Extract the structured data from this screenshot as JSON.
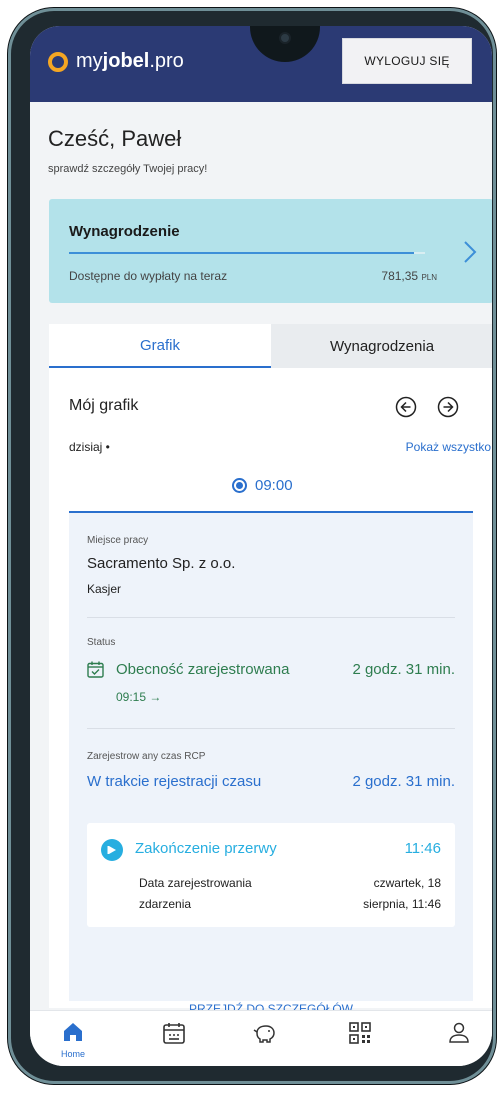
{
  "header": {
    "logo_prefix": "my",
    "logo_bold": "jobel",
    "logo_suffix": ".pro",
    "logout_label": "WYLOGUJ SIĘ"
  },
  "greeting": {
    "title": "Cześć, Paweł",
    "subtitle": "sprawdź szczegóły Twojej pracy!"
  },
  "salary_card": {
    "title": "Wynagrodzenie",
    "available_label": "Dostępne do wypłaty na teraz",
    "amount": "781,35",
    "currency": "PLN",
    "progress_fraction": 0.97
  },
  "tabs": [
    {
      "label": "Grafik",
      "active": true
    },
    {
      "label": "Wynagrodzenia",
      "active": false
    }
  ],
  "schedule": {
    "title": "Mój grafik",
    "day_label": "dzisiaj •",
    "show_all_label": "Pokaż wszystko",
    "selected_time": "09:00"
  },
  "shift": {
    "workplace_label": "Miejsce pracy",
    "workplace": "Sacramento Sp. z o.o.",
    "role": "Kasjer",
    "status_label": "Status",
    "status_text": "Obecność zarejestrowana",
    "status_duration": "2 godz. 31 min.",
    "status_time": "09:15 →",
    "rcp_label": "Zarejestrow any czas RCP",
    "rcp_text": "W trakcie rejestracji czasu",
    "rcp_duration": "2 godz. 31 min."
  },
  "event": {
    "title": "Zakończenie przerwy",
    "time": "11:46",
    "label_line1": "Data zarejestrowania",
    "label_line2": "zdarzenia",
    "date_line1": "czwartek, 18",
    "date_line2": "sierpnia, 11:46"
  },
  "details_link": "PRZEJDŹ DO SZCZEGÓŁÓW",
  "bottom_nav": {
    "home_label": "Home"
  },
  "colors": {
    "header_bg": "#2b3a74",
    "accent_blue": "#2a6fcd",
    "status_green": "#2e7d4f",
    "event_cyan": "#27aee0",
    "salary_bg": "#b3e2ea",
    "logo_orange": "#f5a623"
  },
  "icons": [
    "chevron-right-icon",
    "arrow-left-circle-icon",
    "arrow-right-circle-icon",
    "calendar-check-icon",
    "play-icon",
    "home-icon",
    "calendar-icon",
    "piggy-bank-icon",
    "qr-code-icon",
    "user-icon"
  ]
}
